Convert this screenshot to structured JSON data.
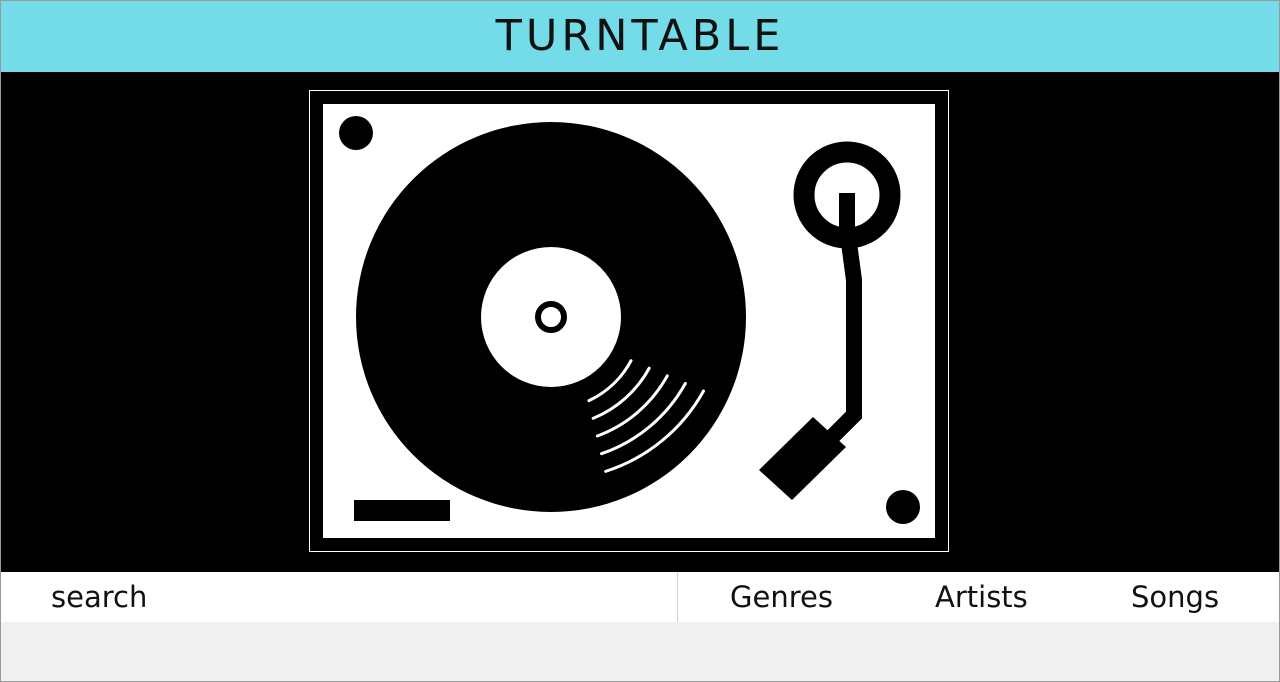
{
  "header": {
    "title": "TURNTABLE"
  },
  "hero": {
    "image_icon": "turntable-icon"
  },
  "nav": {
    "search_label": "search",
    "genres_label": "Genres",
    "artists_label": "Artists",
    "songs_label": "Songs"
  },
  "colors": {
    "header_bg": "#74dce8",
    "hero_bg": "#000000",
    "nav_bg": "#ffffff",
    "page_bg": "#f1f1f1"
  }
}
